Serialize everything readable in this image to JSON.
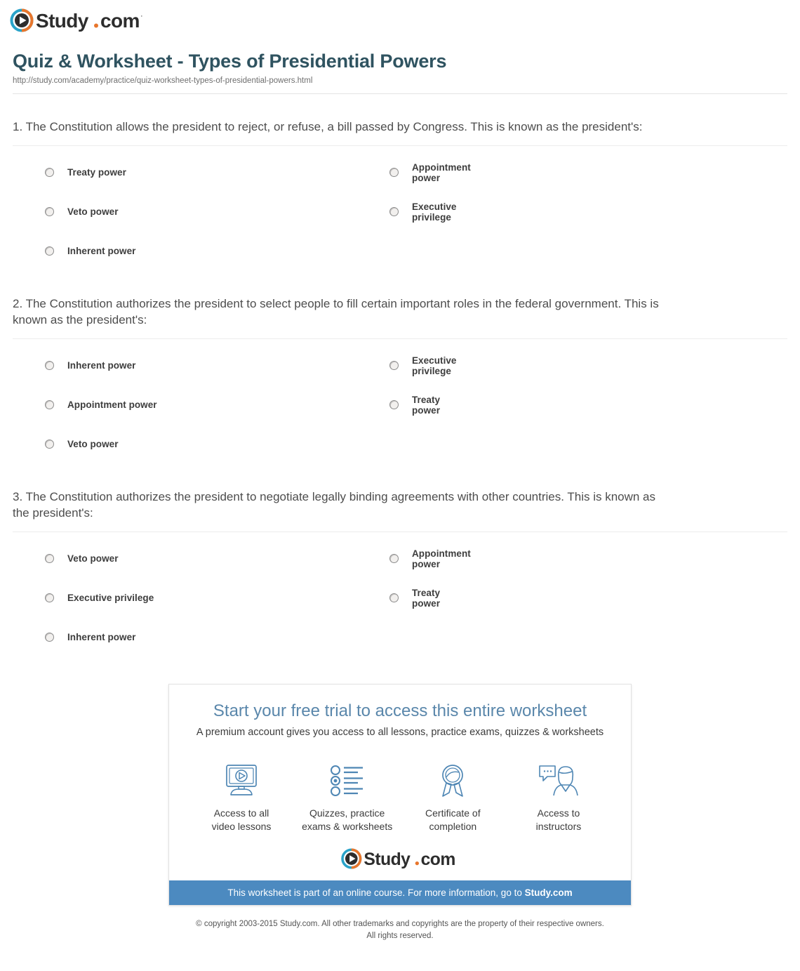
{
  "brand": {
    "name": "Study.com",
    "logo_icon": "play-circle-icon",
    "ring_outer_color": "#e8762c",
    "ring_inner_color": "#29a3c9",
    "wordmark_color": "#2d2d2d",
    "dot_color": "#e8762c"
  },
  "header": {
    "title": "Quiz & Worksheet - Types of Presidential Powers",
    "url": "http://study.com/academy/practice/quiz-worksheet-types-of-presidential-powers.html",
    "title_color": "#2f5360"
  },
  "questions": [
    {
      "text": "1. The Constitution allows the president to reject, or refuse, a bill passed by Congress. This is known as the president's:",
      "left_options": [
        "Treaty power",
        "Veto power",
        "Inherent power"
      ],
      "right_options": [
        "Appointment power",
        "Executive privilege"
      ]
    },
    {
      "text": "2. The Constitution authorizes the president to select people to fill certain important roles in the federal government. This is known as the president's:",
      "left_options": [
        "Inherent power",
        "Appointment power",
        "Veto power"
      ],
      "right_options": [
        "Executive privilege",
        "Treaty power"
      ]
    },
    {
      "text": "3. The Constitution authorizes the president to negotiate legally binding agreements with other countries. This is known as the president's:",
      "left_options": [
        "Veto power",
        "Executive privilege",
        "Inherent power"
      ],
      "right_options": [
        "Appointment power",
        "Treaty power"
      ]
    }
  ],
  "promo": {
    "title": "Start your free trial to access this entire worksheet",
    "subtitle": "A premium account gives you access to all lessons, practice exams, quizzes & worksheets",
    "title_color": "#5a87ab",
    "features": [
      {
        "icon": "monitor-play-icon",
        "label_line1": "Access to all",
        "label_line2": "video lessons"
      },
      {
        "icon": "checklist-icon",
        "label_line1": "Quizzes, practice",
        "label_line2": "exams & worksheets"
      },
      {
        "icon": "award-ribbon-icon",
        "label_line1": "Certificate of",
        "label_line2": "completion"
      },
      {
        "icon": "instructor-chat-icon",
        "label_line1": "Access to",
        "label_line2": "instructors"
      }
    ],
    "banner_text_prefix": "This worksheet is part of an online course. For more information, go to ",
    "banner_link_text": "Study.com",
    "banner_color": "#4c8ac0",
    "icon_color": "#4e86b4"
  },
  "footer": {
    "line1": "© copyright 2003-2015 Study.com. All other trademarks and copyrights are the property of their respective owners.",
    "line2": "All rights reserved."
  }
}
